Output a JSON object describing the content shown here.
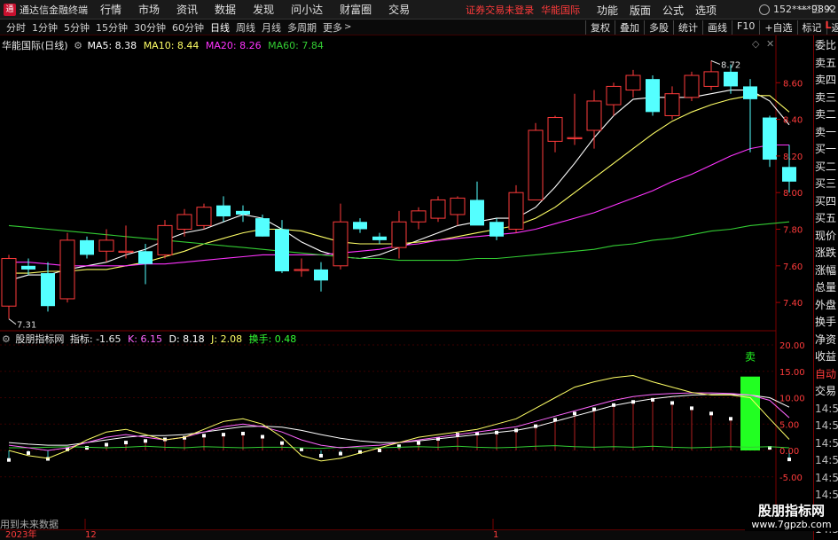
{
  "app": {
    "title": "通达信金融终端",
    "status": "证券交易未登录",
    "brand": "华能国际",
    "user": "152****9892",
    "logo_char": "通"
  },
  "menu": [
    "行情",
    "市场",
    "资讯",
    "数据",
    "发现",
    "问小达",
    "财富圈",
    "交易"
  ],
  "menu_right": [
    "功能",
    "版面",
    "公式",
    "选项"
  ],
  "window_controls": [
    "—",
    "□",
    "✕"
  ],
  "periods": [
    "分时",
    "1分钟",
    "5分钟",
    "15分钟",
    "30分钟",
    "60分钟",
    "日线",
    "周线",
    "月线",
    "多周期",
    "更多"
  ],
  "active_period": "日线",
  "tools": [
    "复权",
    "叠加",
    "多股",
    "统计",
    "画线",
    "F10",
    "+自选",
    "标记",
    "返回"
  ],
  "l_label": "L",
  "main": {
    "name": "华能国际(日线)",
    "ma": [
      {
        "label": "MA5: 8.38",
        "color": "#ffffff"
      },
      {
        "label": "MA10: 8.44",
        "color": "#ffff66"
      },
      {
        "label": "MA20: 8.26",
        "color": "#ff33ff"
      },
      {
        "label": "MA60: 7.84",
        "color": "#33cc33"
      }
    ],
    "price_axis": [
      "8.60",
      "8.40",
      "8.20",
      "8.00",
      "7.80",
      "7.60",
      "7.40"
    ],
    "high_label": "8.72",
    "low_label": "7.31"
  },
  "indicator": {
    "name": "股朋指标网",
    "label": "指标: -1.65",
    "values": [
      {
        "label": "K: 6.15",
        "color": "#ff66ff"
      },
      {
        "label": "D: 8.18",
        "color": "#ffffff"
      },
      {
        "label": "J: 2.08",
        "color": "#ffff66"
      },
      {
        "label": "换手: 0.48",
        "color": "#33ff33"
      }
    ],
    "axis": [
      "20.00",
      "15.00",
      "10.00",
      "5.00",
      "0.00",
      "-5.00"
    ],
    "sell_label": "卖"
  },
  "side_panel": [
    {
      "text": "委比",
      "tone": "normal"
    },
    {
      "text": "卖五",
      "tone": "normal"
    },
    {
      "text": "卖四",
      "tone": "normal"
    },
    {
      "text": "卖三",
      "tone": "normal"
    },
    {
      "text": "卖二",
      "tone": "normal"
    },
    {
      "text": "卖一",
      "tone": "normal"
    },
    {
      "text": "买一",
      "tone": "normal"
    },
    {
      "text": "买二",
      "tone": "normal"
    },
    {
      "text": "买三",
      "tone": "normal"
    },
    {
      "text": "买四",
      "tone": "normal"
    },
    {
      "text": "买五",
      "tone": "normal"
    },
    {
      "text": "现价",
      "tone": "normal"
    },
    {
      "text": "涨跌",
      "tone": "normal"
    },
    {
      "text": "涨幅",
      "tone": "normal"
    },
    {
      "text": "总量",
      "tone": "normal"
    },
    {
      "text": "外盘",
      "tone": "normal"
    },
    {
      "text": "换手",
      "tone": "normal"
    },
    {
      "text": "净资",
      "tone": "normal"
    },
    {
      "text": "收益",
      "tone": "normal"
    },
    {
      "text": "自动",
      "tone": "red"
    },
    {
      "text": "交易",
      "tone": "normal"
    },
    {
      "text": "14:56",
      "tone": "gray"
    },
    {
      "text": "14:56",
      "tone": "gray"
    },
    {
      "text": "14:56",
      "tone": "gray"
    },
    {
      "text": "14:56",
      "tone": "gray"
    },
    {
      "text": "14:56",
      "tone": "gray"
    },
    {
      "text": "14:56",
      "tone": "gray"
    },
    {
      "text": "14:56",
      "tone": "gray"
    },
    {
      "text": "14:56",
      "tone": "gray"
    }
  ],
  "bottom": {
    "future_label": "用到未来数据",
    "dates": [
      "2023年",
      "12",
      "1"
    ]
  },
  "watermark": {
    "name": "股朋指标网",
    "url": "www.7gpzb.com"
  },
  "candles": [
    {
      "o": 7.38,
      "h": 7.66,
      "l": 7.31,
      "c": 7.64
    },
    {
      "o": 7.6,
      "h": 7.64,
      "l": 7.55,
      "c": 7.58
    },
    {
      "o": 7.56,
      "h": 7.62,
      "l": 7.35,
      "c": 7.38
    },
    {
      "o": 7.42,
      "h": 7.78,
      "l": 7.4,
      "c": 7.74
    },
    {
      "o": 7.74,
      "h": 7.76,
      "l": 7.64,
      "c": 7.66
    },
    {
      "o": 7.68,
      "h": 7.8,
      "l": 7.62,
      "c": 7.74
    },
    {
      "o": 7.68,
      "h": 7.82,
      "l": 7.64,
      "c": 7.68
    },
    {
      "o": 7.68,
      "h": 7.72,
      "l": 7.5,
      "c": 7.61
    },
    {
      "o": 7.66,
      "h": 7.85,
      "l": 7.64,
      "c": 7.82
    },
    {
      "o": 7.8,
      "h": 7.91,
      "l": 7.76,
      "c": 7.88
    },
    {
      "o": 7.82,
      "h": 7.94,
      "l": 7.8,
      "c": 7.92
    },
    {
      "o": 7.93,
      "h": 7.98,
      "l": 7.84,
      "c": 7.87
    },
    {
      "o": 7.9,
      "h": 7.93,
      "l": 7.84,
      "c": 7.88
    },
    {
      "o": 7.86,
      "h": 7.88,
      "l": 7.76,
      "c": 7.76
    },
    {
      "o": 7.8,
      "h": 7.85,
      "l": 7.56,
      "c": 7.57
    },
    {
      "o": 7.58,
      "h": 7.64,
      "l": 7.54,
      "c": 7.58
    },
    {
      "o": 7.58,
      "h": 7.62,
      "l": 7.46,
      "c": 7.52
    },
    {
      "o": 7.6,
      "h": 7.94,
      "l": 7.58,
      "c": 7.84
    },
    {
      "o": 7.84,
      "h": 7.86,
      "l": 7.78,
      "c": 7.8
    },
    {
      "o": 7.76,
      "h": 7.78,
      "l": 7.72,
      "c": 7.74
    },
    {
      "o": 7.7,
      "h": 7.9,
      "l": 7.64,
      "c": 7.84
    },
    {
      "o": 7.84,
      "h": 7.92,
      "l": 7.8,
      "c": 7.9
    },
    {
      "o": 7.86,
      "h": 7.98,
      "l": 7.84,
      "c": 7.96
    },
    {
      "o": 7.88,
      "h": 7.98,
      "l": 7.82,
      "c": 7.97
    },
    {
      "o": 7.96,
      "h": 8.06,
      "l": 7.92,
      "c": 7.82
    },
    {
      "o": 7.84,
      "h": 7.86,
      "l": 7.74,
      "c": 7.76
    },
    {
      "o": 7.8,
      "h": 8.04,
      "l": 7.78,
      "c": 8.0
    },
    {
      "o": 7.96,
      "h": 8.38,
      "l": 7.96,
      "c": 8.34
    },
    {
      "o": 8.28,
      "h": 8.42,
      "l": 8.22,
      "c": 8.41
    },
    {
      "o": 8.3,
      "h": 8.54,
      "l": 8.26,
      "c": 8.3
    },
    {
      "o": 8.34,
      "h": 8.56,
      "l": 8.24,
      "c": 8.5
    },
    {
      "o": 8.48,
      "h": 8.6,
      "l": 8.42,
      "c": 8.58
    },
    {
      "o": 8.56,
      "h": 8.67,
      "l": 8.52,
      "c": 8.64
    },
    {
      "o": 8.62,
      "h": 8.64,
      "l": 8.42,
      "c": 8.44
    },
    {
      "o": 8.42,
      "h": 8.58,
      "l": 8.4,
      "c": 8.54
    },
    {
      "o": 8.52,
      "h": 8.66,
      "l": 8.5,
      "c": 8.64
    },
    {
      "o": 8.58,
      "h": 8.72,
      "l": 8.56,
      "c": 8.66
    },
    {
      "o": 8.66,
      "h": 8.7,
      "l": 8.54,
      "c": 8.58
    },
    {
      "o": 8.58,
      "h": 8.62,
      "l": 8.22,
      "c": 8.51
    },
    {
      "o": 8.41,
      "h": 8.42,
      "l": 8.14,
      "c": 8.18
    },
    {
      "o": 8.14,
      "h": 8.26,
      "l": 8.0,
      "c": 8.06
    }
  ],
  "ma_lines": {
    "MA5": [
      7.52,
      7.55,
      7.55,
      7.58,
      7.6,
      7.62,
      7.66,
      7.69,
      7.74,
      7.78,
      7.8,
      7.84,
      7.88,
      7.86,
      7.8,
      7.73,
      7.68,
      7.65,
      7.64,
      7.66,
      7.7,
      7.74,
      7.78,
      7.82,
      7.84,
      7.86,
      7.86,
      7.92,
      8.03,
      8.16,
      8.3,
      8.42,
      8.51,
      8.52,
      8.52,
      8.52,
      8.54,
      8.56,
      8.56,
      8.5,
      8.37
    ],
    "MA10": [
      7.56,
      7.56,
      7.57,
      7.57,
      7.58,
      7.58,
      7.6,
      7.62,
      7.65,
      7.68,
      7.72,
      7.75,
      7.78,
      7.8,
      7.8,
      7.79,
      7.76,
      7.73,
      7.72,
      7.72,
      7.72,
      7.73,
      7.74,
      7.76,
      7.78,
      7.8,
      7.82,
      7.86,
      7.92,
      8.0,
      8.08,
      8.16,
      8.24,
      8.32,
      8.39,
      8.44,
      8.48,
      8.51,
      8.53,
      8.53,
      8.44
    ],
    "MA20": [
      7.62,
      7.62,
      7.61,
      7.6,
      7.6,
      7.6,
      7.6,
      7.61,
      7.61,
      7.62,
      7.63,
      7.64,
      7.65,
      7.66,
      7.66,
      7.66,
      7.66,
      7.67,
      7.68,
      7.69,
      7.71,
      7.72,
      7.74,
      7.75,
      7.76,
      7.77,
      7.78,
      7.8,
      7.83,
      7.86,
      7.89,
      7.93,
      7.97,
      8.01,
      8.06,
      8.1,
      8.15,
      8.2,
      8.24,
      8.26,
      8.26
    ],
    "MA60": [
      7.82,
      7.81,
      7.8,
      7.79,
      7.78,
      7.77,
      7.76,
      7.75,
      7.74,
      7.73,
      7.72,
      7.71,
      7.7,
      7.69,
      7.68,
      7.67,
      7.66,
      7.65,
      7.64,
      7.64,
      7.63,
      7.63,
      7.63,
      7.63,
      7.64,
      7.64,
      7.65,
      7.66,
      7.67,
      7.68,
      7.69,
      7.71,
      7.72,
      7.74,
      7.75,
      7.77,
      7.79,
      7.8,
      7.82,
      7.83,
      7.84
    ]
  },
  "ind_lines": {
    "K": [
      1.0,
      0.5,
      0.0,
      0.5,
      1.5,
      2.5,
      3.0,
      2.5,
      2.0,
      2.5,
      3.5,
      4.5,
      5.0,
      4.5,
      3.5,
      2.0,
      1.0,
      0.5,
      0.8,
      1.0,
      1.5,
      2.0,
      2.5,
      3.0,
      3.5,
      4.0,
      4.5,
      5.5,
      6.5,
      7.5,
      8.5,
      9.5,
      10.2,
      10.6,
      10.8,
      10.9,
      10.9,
      10.8,
      10.5,
      9.5,
      6.2
    ],
    "D": [
      1.5,
      1.2,
      1.0,
      1.0,
      1.5,
      2.0,
      2.5,
      2.8,
      2.8,
      3.0,
      3.5,
      4.0,
      4.5,
      4.6,
      4.4,
      3.8,
      3.0,
      2.3,
      1.8,
      1.5,
      1.5,
      1.8,
      2.2,
      2.6,
      3.0,
      3.4,
      3.8,
      4.5,
      5.5,
      6.5,
      7.5,
      8.5,
      9.2,
      9.8,
      10.2,
      10.5,
      10.6,
      10.6,
      10.5,
      10.0,
      8.2
    ],
    "J": [
      0.0,
      -1.0,
      -1.5,
      0.0,
      2.0,
      3.5,
      4.0,
      3.0,
      2.0,
      2.5,
      4.0,
      5.5,
      6.0,
      5.0,
      2.5,
      -1.0,
      -2.0,
      -1.5,
      -0.5,
      0.5,
      1.5,
      2.5,
      3.0,
      3.5,
      4.0,
      5.0,
      6.0,
      8.0,
      10.0,
      12.0,
      13.0,
      13.8,
      14.2,
      13.0,
      12.0,
      11.0,
      10.5,
      10.5,
      10.0,
      6.0,
      2.1
    ],
    "T": [
      0.5,
      0.5,
      0.6,
      0.7,
      0.6,
      0.5,
      0.6,
      0.8,
      0.6,
      0.5,
      0.7,
      0.6,
      0.5,
      0.6,
      0.6,
      0.5,
      0.4,
      0.6,
      0.5,
      0.5,
      0.6,
      0.7,
      0.6,
      0.8,
      0.6,
      0.5,
      0.6,
      0.8,
      0.9,
      0.7,
      0.6,
      0.7,
      0.6,
      0.8,
      0.6,
      0.5,
      0.6,
      0.7,
      0.6,
      0.7,
      0.5
    ],
    "bar": [
      -1.8,
      -0.5,
      -1.6,
      0.2,
      0.5,
      1.1,
      1.5,
      1.8,
      2.1,
      2.4,
      2.8,
      3.0,
      3.2,
      2.6,
      1.4,
      0.2,
      -1.0,
      -0.6,
      -0.3,
      0.0,
      0.8,
      1.4,
      2.2,
      3.0,
      3.2,
      3.4,
      3.8,
      4.6,
      5.8,
      7.0,
      7.8,
      8.6,
      9.2,
      9.6,
      9.0,
      8.0,
      7.0,
      6.0,
      0.8,
      0.5,
      -1.7
    ],
    "sell_index": 38,
    "sell_value": 14.0
  }
}
